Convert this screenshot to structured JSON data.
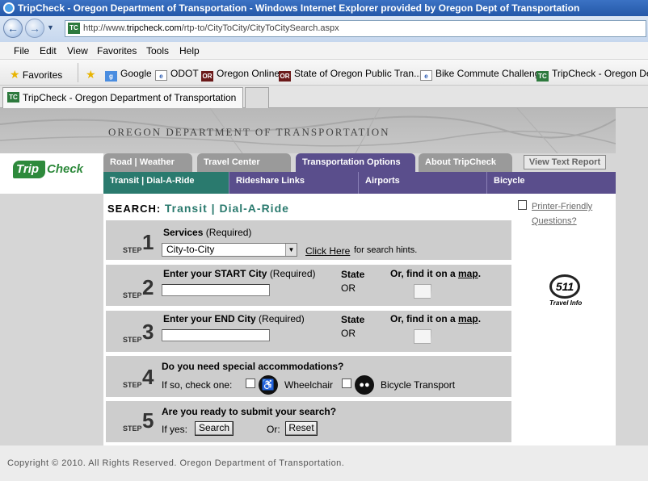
{
  "window": {
    "title": "TripCheck - Oregon Department of Transportation - Windows Internet Explorer provided by Oregon Dept of Transportation"
  },
  "addressbar": {
    "url_domain_prefix": "http://www.",
    "url_domain": "tripcheck.com",
    "url_path": "/rtp-to/CityToCity/CityToCitySearch.aspx",
    "site_icon": "TC"
  },
  "menubar": {
    "items": [
      "File",
      "Edit",
      "View",
      "Favorites",
      "Tools",
      "Help"
    ]
  },
  "favorites_bar": {
    "favorites_label": "Favorites",
    "links": [
      {
        "label": "Google",
        "icon": "google-icon"
      },
      {
        "label": "ODOT",
        "icon": "ie-page-icon"
      },
      {
        "label": "Oregon Online",
        "icon": "or-icon",
        "icon_text": "OR"
      },
      {
        "label": "State of Oregon Public Tran...",
        "icon": "or-icon",
        "icon_text": "OR"
      },
      {
        "label": "Bike Commute Challenge",
        "icon": "ie-page-icon"
      },
      {
        "label": "TripCheck - Oregon Depa",
        "icon": "tc-icon",
        "icon_text": "TC"
      }
    ]
  },
  "tabs": {
    "active_label": "TripCheck - Oregon Department of Transportation"
  },
  "site": {
    "org_title": "OREGON DEPARTMENT OF TRANSPORTATION",
    "logo_trip": "Trip",
    "logo_check": "Check",
    "top_nav": [
      "Road | Weather",
      "Travel Center",
      "Transportation Options",
      "About TripCheck"
    ],
    "view_text_report": "View Text Report",
    "sub_nav": [
      "Transit | Dial-A-Ride",
      "Rideshare Links",
      "Airports",
      "Bicycle"
    ]
  },
  "search": {
    "heading_label": "SEARCH:",
    "heading_crumb": "Transit | Dial-A-Ride",
    "step_word": "STEP",
    "step1": {
      "number": "1",
      "title": "Services",
      "required": "(Required)",
      "selected_option": "City-to-City",
      "hint_link": "Click Here",
      "hint_text": "for search hints."
    },
    "step2": {
      "number": "2",
      "title": "Enter your START City",
      "required": "(Required)",
      "state_label": "State",
      "state_value": "OR",
      "map_prefix": "Or, find it on a",
      "map_link": "map",
      "map_suffix": ".",
      "input_value": ""
    },
    "step3": {
      "number": "3",
      "title": "Enter your END City",
      "required": "(Required)",
      "state_label": "State",
      "state_value": "OR",
      "map_prefix": "Or, find it on a",
      "map_link": "map",
      "map_suffix": ".",
      "input_value": ""
    },
    "step4": {
      "number": "4",
      "title": "Do you need special accommodations?",
      "prompt": "If so, check one:",
      "option1": "Wheelchair",
      "option2": "Bicycle Transport"
    },
    "step5": {
      "number": "5",
      "title": "Are you ready to submit your search?",
      "prompt": "If yes:",
      "search_button": "Search",
      "or_label": "Or:",
      "reset_button": "Reset"
    }
  },
  "sidebar": {
    "printer_friendly": "Printer-Friendly",
    "questions": "Questions?",
    "logo_511": "511",
    "logo_511_sub": "Travel Info"
  },
  "footer": {
    "copyright": "Copyright © 2010. All Rights Reserved. Oregon Department of Transportation."
  },
  "colors": {
    "accent_green": "#2a7a6e",
    "subnav_purple": "#5a4e8c",
    "topnav_gray": "#9a9a9a"
  }
}
